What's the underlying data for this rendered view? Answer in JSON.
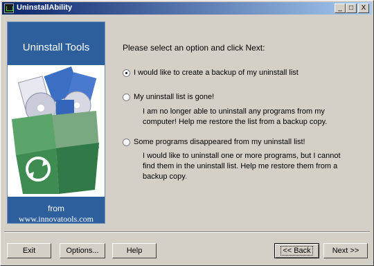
{
  "window": {
    "title": "UninstallAbility",
    "controls": [
      "_",
      "□",
      "X"
    ]
  },
  "banner": {
    "title": "Uninstall Tools",
    "from_label": "from",
    "url": "www.innovatools.com"
  },
  "wizard": {
    "prompt": "Please select an option and click Next:",
    "options": [
      {
        "label": "I would like to create a backup of my uninstall list",
        "selected": true,
        "description": ""
      },
      {
        "label": "My uninstall list is gone!",
        "selected": false,
        "description": "I am no longer able to uninstall any programs from my computer! Help me restore the list from a backup copy."
      },
      {
        "label": "Some programs disappeared from my uninstall list!",
        "selected": false,
        "description": "I would like to uninstall one or more programs, but I cannot find them in the uninstall list. Help me restore them from a backup copy."
      }
    ]
  },
  "buttons": {
    "exit": "Exit",
    "options": "Options...",
    "help": "Help",
    "back": "<< Back",
    "next": "Next >>"
  }
}
